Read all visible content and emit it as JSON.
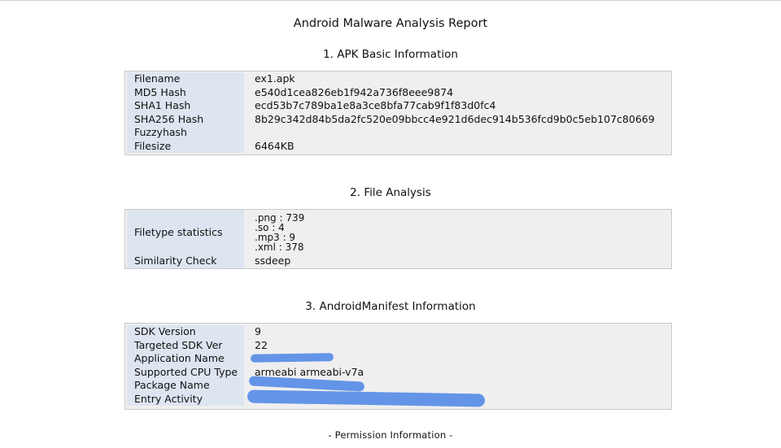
{
  "report_title": "Android Malware Analysis Report",
  "sections": {
    "basic": {
      "heading": "1. APK Basic Information",
      "rows": [
        {
          "label": "Filename",
          "value": "ex1.apk"
        },
        {
          "label": "MD5 Hash",
          "value": "e540d1cea826eb1f942a736f8eee9874"
        },
        {
          "label": "SHA1 Hash",
          "value": "ecd53b7c789ba1e8a3ce8bfa77cab9f1f83d0fc4"
        },
        {
          "label": "SHA256 Hash",
          "value": "8b29c342d84b5da2fc520e09bbcc4e921d6dec914b536fcd9b0c5eb107c80669"
        },
        {
          "label": "Fuzzyhash",
          "value": ""
        },
        {
          "label": "Filesize",
          "value": "6464KB"
        }
      ]
    },
    "file": {
      "heading": "2. File Analysis",
      "filetype_label": "Filetype statistics",
      "filetype_lines": [
        ".png : 739",
        ".so : 4",
        ".mp3 : 9",
        ".xml : 378"
      ],
      "similarity_label": "Similarity Check",
      "similarity_value": "ssdeep"
    },
    "manifest": {
      "heading": "3. AndroidManifest Information",
      "rows": [
        {
          "label": "SDK Version",
          "value": "9"
        },
        {
          "label": "Targeted SDK Ver",
          "value": "22"
        },
        {
          "label": "Application Name",
          "value": ""
        },
        {
          "label": "Supported CPU Type",
          "value": "armeabi armeabi-v7a"
        },
        {
          "label": "Package Name",
          "value": ""
        },
        {
          "label": "Entry Activity",
          "value": ""
        }
      ]
    },
    "permission": {
      "heading": "- Permission Information -"
    }
  },
  "colors": {
    "label_bg": "#dde5f0",
    "table_bg": "#efefef",
    "redaction": "#5b8ee6"
  }
}
